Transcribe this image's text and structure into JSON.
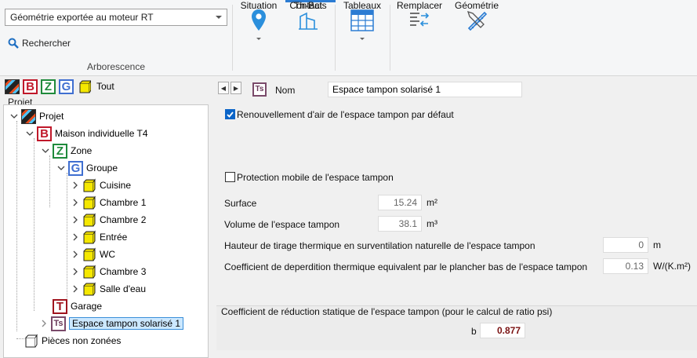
{
  "ribbon": {
    "geometry_select": "Géométrie exportée au moteur RT",
    "search_label": "Rechercher",
    "section_label": "Arborescence",
    "buttons": {
      "situation": "Situation",
      "contacts_l1": "Contacts",
      "contacts_l2": "Th-Bat",
      "tableaux": "Tableaux",
      "remplacer": "Remplacer",
      "geometrie": "Géométrie"
    }
  },
  "filter_bar": {
    "badges": [
      "B",
      "Z",
      "G"
    ],
    "all_label": "Tout"
  },
  "tree": {
    "header": "Projet",
    "root": "Projet",
    "house_badge": "B",
    "house": "Maison individuelle T4",
    "zone_badge": "Z",
    "zone": "Zone",
    "group_badge": "G",
    "group": "Groupe",
    "rooms": [
      "Cuisine",
      "Chambre 1",
      "Chambre 2",
      "Entrée",
      "WC",
      "Chambre 3",
      "Salle d'eau"
    ],
    "garage_badge": "T",
    "garage": "Garage",
    "buffer_badge": "Ts",
    "buffer": "Espace tampon solarisé 1",
    "unzoned": "Pièces non zonées"
  },
  "form": {
    "type_badge": "Ts",
    "name_label": "Nom",
    "name_value": "Espace tampon solarisé 1",
    "renouvellement_label": "Renouvellement d'air de l'espace tampon par défaut",
    "renouvellement_checked": true,
    "protection_label": "Protection mobile de l'espace tampon",
    "protection_checked": false,
    "surface_label": "Surface",
    "surface_value": "15.24",
    "surface_unit": "m²",
    "volume_label": "Volume de l'espace tampon",
    "volume_value": "38.1",
    "volume_unit": "m³",
    "hauteur_label": "Hauteur de tirage thermique en surventilation naturelle de l'espace tampon",
    "hauteur_value": "0",
    "hauteur_unit": "m",
    "coef_label": "Coefficient de deperdition thermique equivalent par le plancher bas de l'espace tampon",
    "coef_value": "0.13",
    "coef_unit": "W/(K.m²)",
    "group_title": "Coefficient de réduction statique de l'espace tampon (pour le calcul de ratio psi)",
    "b_label": "b",
    "b_value": "0.877"
  },
  "colors": {
    "accent": "#2b7cd3",
    "b_value": "#7a1212"
  }
}
